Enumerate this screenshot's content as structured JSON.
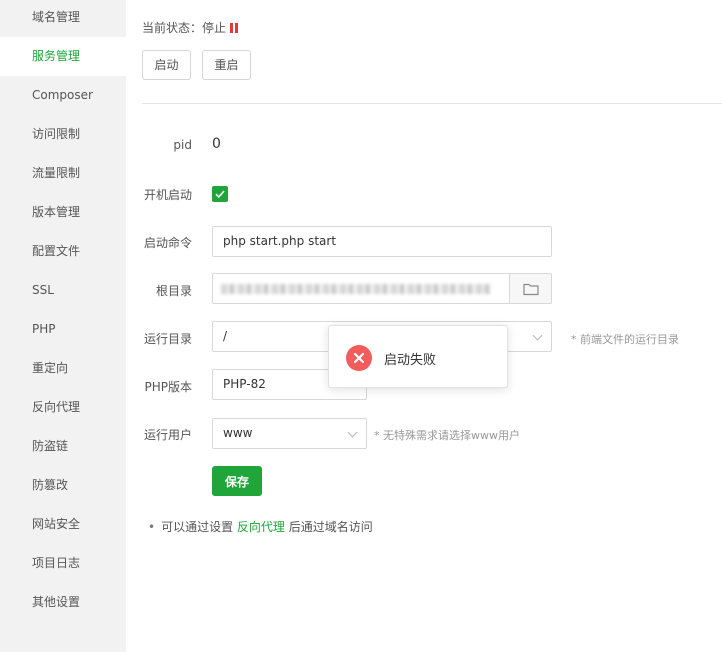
{
  "sidebar": {
    "items": [
      {
        "label": "域名管理",
        "active": false
      },
      {
        "label": "服务管理",
        "active": true
      },
      {
        "label": "Composer",
        "active": false
      },
      {
        "label": "访问限制",
        "active": false
      },
      {
        "label": "流量限制",
        "active": false
      },
      {
        "label": "版本管理",
        "active": false
      },
      {
        "label": "配置文件",
        "active": false
      },
      {
        "label": "SSL",
        "active": false
      },
      {
        "label": "PHP",
        "active": false
      },
      {
        "label": "重定向",
        "active": false
      },
      {
        "label": "反向代理",
        "active": false
      },
      {
        "label": "防盗链",
        "active": false
      },
      {
        "label": "防篡改",
        "active": false
      },
      {
        "label": "网站安全",
        "active": false
      },
      {
        "label": "项目日志",
        "active": false
      },
      {
        "label": "其他设置",
        "active": false
      }
    ]
  },
  "status": {
    "label": "当前状态：",
    "value": "停止",
    "icon": "pause-icon"
  },
  "buttons": {
    "start": "启动",
    "restart": "重启",
    "save": "保存"
  },
  "form": {
    "pid": {
      "label": "pid",
      "value": "0"
    },
    "autostart": {
      "label": "开机启动",
      "checked": true
    },
    "command": {
      "label": "启动命令",
      "value": "php start.php start"
    },
    "root_dir": {
      "label": "根目录",
      "value": "",
      "icon": "folder-icon"
    },
    "run_dir": {
      "label": "运行目录",
      "value": "/",
      "hint": "* 前端文件的运行目录"
    },
    "php_version": {
      "label": "PHP版本",
      "value": "PHP-82"
    },
    "run_user": {
      "label": "运行用户",
      "value": "www",
      "hint": "* 无特殊需求请选择www用户"
    }
  },
  "tip": {
    "bullet": "•",
    "prefix": "可以通过设置",
    "link": "反向代理",
    "suffix": "后通过域名访问"
  },
  "toast": {
    "message": "启动失败",
    "icon": "error-icon"
  },
  "colors": {
    "accent": "#20a53a",
    "error": "#f25c5c",
    "status_stop": "#e03b3b",
    "sidebar_bg": "#f2f2f2"
  }
}
